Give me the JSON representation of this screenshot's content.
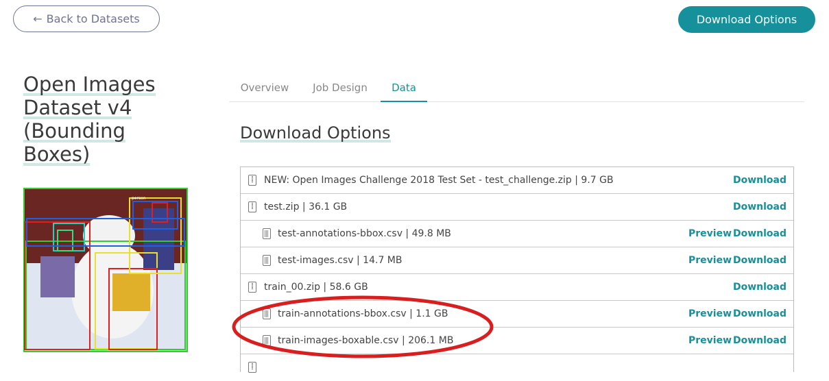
{
  "header": {
    "back_label": "Back to Datasets",
    "download_options_label": "Download Options"
  },
  "dataset": {
    "title_lines": [
      "Open Images",
      "Dataset v4",
      "(Bounding",
      "Boxes)"
    ],
    "thumbnail_label": "person"
  },
  "tabs": [
    {
      "label": "Overview",
      "active": false
    },
    {
      "label": "Job Design",
      "active": false
    },
    {
      "label": "Data",
      "active": true
    }
  ],
  "section_title": "Download Options",
  "files": [
    {
      "name": "NEW: Open Images Challenge 2018 Test Set - test_challenge.zip | 9.7 GB",
      "type": "zip",
      "indent": false,
      "preview": false
    },
    {
      "name": "test.zip | 36.1 GB",
      "type": "zip",
      "indent": false,
      "preview": false
    },
    {
      "name": "test-annotations-bbox.csv | 49.8 MB",
      "type": "csv",
      "indent": true,
      "preview": true
    },
    {
      "name": "test-images.csv | 14.7 MB",
      "type": "csv",
      "indent": true,
      "preview": true
    },
    {
      "name": "train_00.zip | 58.6 GB",
      "type": "zip",
      "indent": false,
      "preview": false
    },
    {
      "name": "train-annotations-bbox.csv | 1.1 GB",
      "type": "csv",
      "indent": true,
      "preview": true
    },
    {
      "name": "train-images-boxable.csv | 206.1 MB",
      "type": "csv",
      "indent": true,
      "preview": true
    }
  ],
  "actions": {
    "preview_label": "Preview",
    "download_label": "Download"
  },
  "colors": {
    "accent": "#16909b",
    "annotation_ellipse": "#d81f1f"
  }
}
